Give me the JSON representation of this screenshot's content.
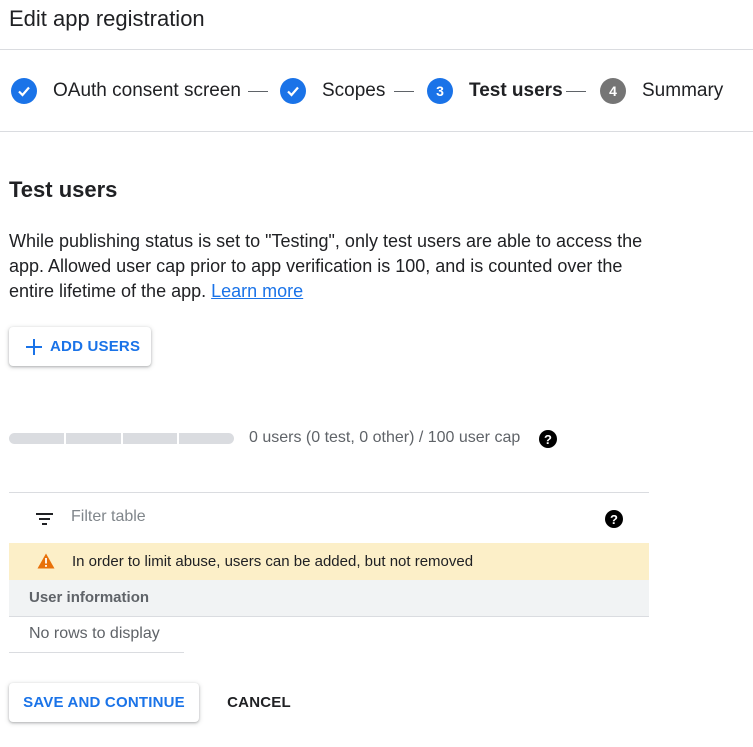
{
  "header": {
    "title": "Edit app registration"
  },
  "stepper": {
    "steps": [
      {
        "number": "",
        "label": "OAuth consent screen",
        "state": "done"
      },
      {
        "number": "",
        "label": "Scopes",
        "state": "done"
      },
      {
        "number": "3",
        "label": "Test users",
        "state": "active"
      },
      {
        "number": "4",
        "label": "Summary",
        "state": "pending"
      }
    ]
  },
  "section": {
    "title": "Test users",
    "description": "While publishing status is set to \"Testing\", only test users are able to access the app. Allowed user cap prior to app verification is 100, and is counted over the entire lifetime of the app. ",
    "learn_more": "Learn more"
  },
  "add_users": {
    "label": "ADD USERS",
    "icon": "plus-icon"
  },
  "user_cap": {
    "text": "0 users (0 test, 0 other) / 100 user cap",
    "used": 0,
    "cap": 100,
    "help_icon": "help-icon"
  },
  "table": {
    "filter_placeholder": "Filter table",
    "warning": "In order to limit abuse, users can be added, but not removed",
    "column_header": "User information",
    "empty_text": "No rows to display"
  },
  "actions": {
    "save": "SAVE AND CONTINUE",
    "cancel": "CANCEL"
  },
  "colors": {
    "accent": "#1a73e8",
    "warning_bg": "#fcefc8",
    "warning_icon": "#e8710a",
    "pending_step": "#757575"
  }
}
